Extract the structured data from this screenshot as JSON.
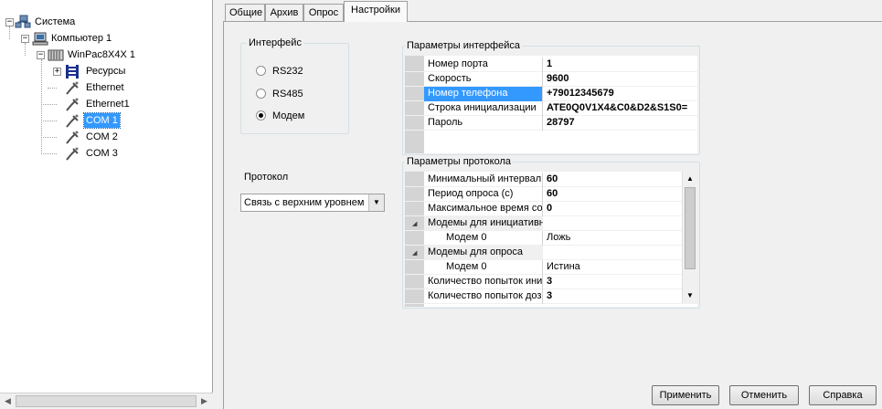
{
  "tree": {
    "items": [
      {
        "label": "Система",
        "icon": "network-system-icon",
        "expander": "−"
      },
      {
        "label": "Компьютер 1",
        "icon": "computer-icon",
        "expander": "−"
      },
      {
        "label": "WinPac8X4X 1",
        "icon": "controller-icon",
        "expander": "−"
      },
      {
        "label": "Ресурсы",
        "icon": "resources-icon",
        "expander": "+"
      },
      {
        "label": "Ethernet",
        "icon": "port-icon"
      },
      {
        "label": "Ethernet1",
        "icon": "port-icon"
      },
      {
        "label": "COM 1",
        "icon": "port-icon",
        "selected": true
      },
      {
        "label": "COM 2",
        "icon": "port-icon"
      },
      {
        "label": "COM 3",
        "icon": "port-icon"
      }
    ]
  },
  "tabs": [
    {
      "label": "Общие"
    },
    {
      "label": "Архив"
    },
    {
      "label": "Опрос"
    },
    {
      "label": "Настройки",
      "active": true
    }
  ],
  "interface": {
    "title": "Интерфейс",
    "options": [
      {
        "label": "RS232",
        "checked": false
      },
      {
        "label": "RS485",
        "checked": false
      },
      {
        "label": "Модем",
        "checked": true
      }
    ]
  },
  "protocol": {
    "label": "Протокол",
    "selected": "Связь с верхним уровнем"
  },
  "interface_params": {
    "title": "Параметры интерфейса",
    "rows": [
      {
        "name": "Номер порта",
        "value": "1"
      },
      {
        "name": "Скорость",
        "value": "9600"
      },
      {
        "name": "Номер телефона",
        "value": "+79012345679",
        "selected": true
      },
      {
        "name": "Строка инициализации",
        "value": "ATE0Q0V1X4&C0&D2&S1S0="
      },
      {
        "name": "Пароль",
        "value": "28797"
      }
    ]
  },
  "protocol_params": {
    "title": "Параметры протокола",
    "rows": [
      {
        "name": "Минимальный интервал",
        "value": "60",
        "bold": true
      },
      {
        "name": "Период опроса (с)",
        "value": "60",
        "bold": true
      },
      {
        "name": "Максимальное время со",
        "value": "0",
        "bold": true
      },
      {
        "name": "Модемы для инициативн",
        "value": "",
        "category": true
      },
      {
        "name": "Модем 0",
        "value": "Ложь",
        "indent": true
      },
      {
        "name": "Модемы для опроса",
        "value": "",
        "category": true
      },
      {
        "name": "Модем 0",
        "value": "Истина",
        "indent": true
      },
      {
        "name": "Количество попыток ини",
        "value": "3",
        "bold": true
      },
      {
        "name": "Количество попыток доз",
        "value": "3",
        "bold": true
      }
    ]
  },
  "buttons": {
    "apply": "Применить",
    "cancel": "Отменить",
    "help": "Справка"
  }
}
